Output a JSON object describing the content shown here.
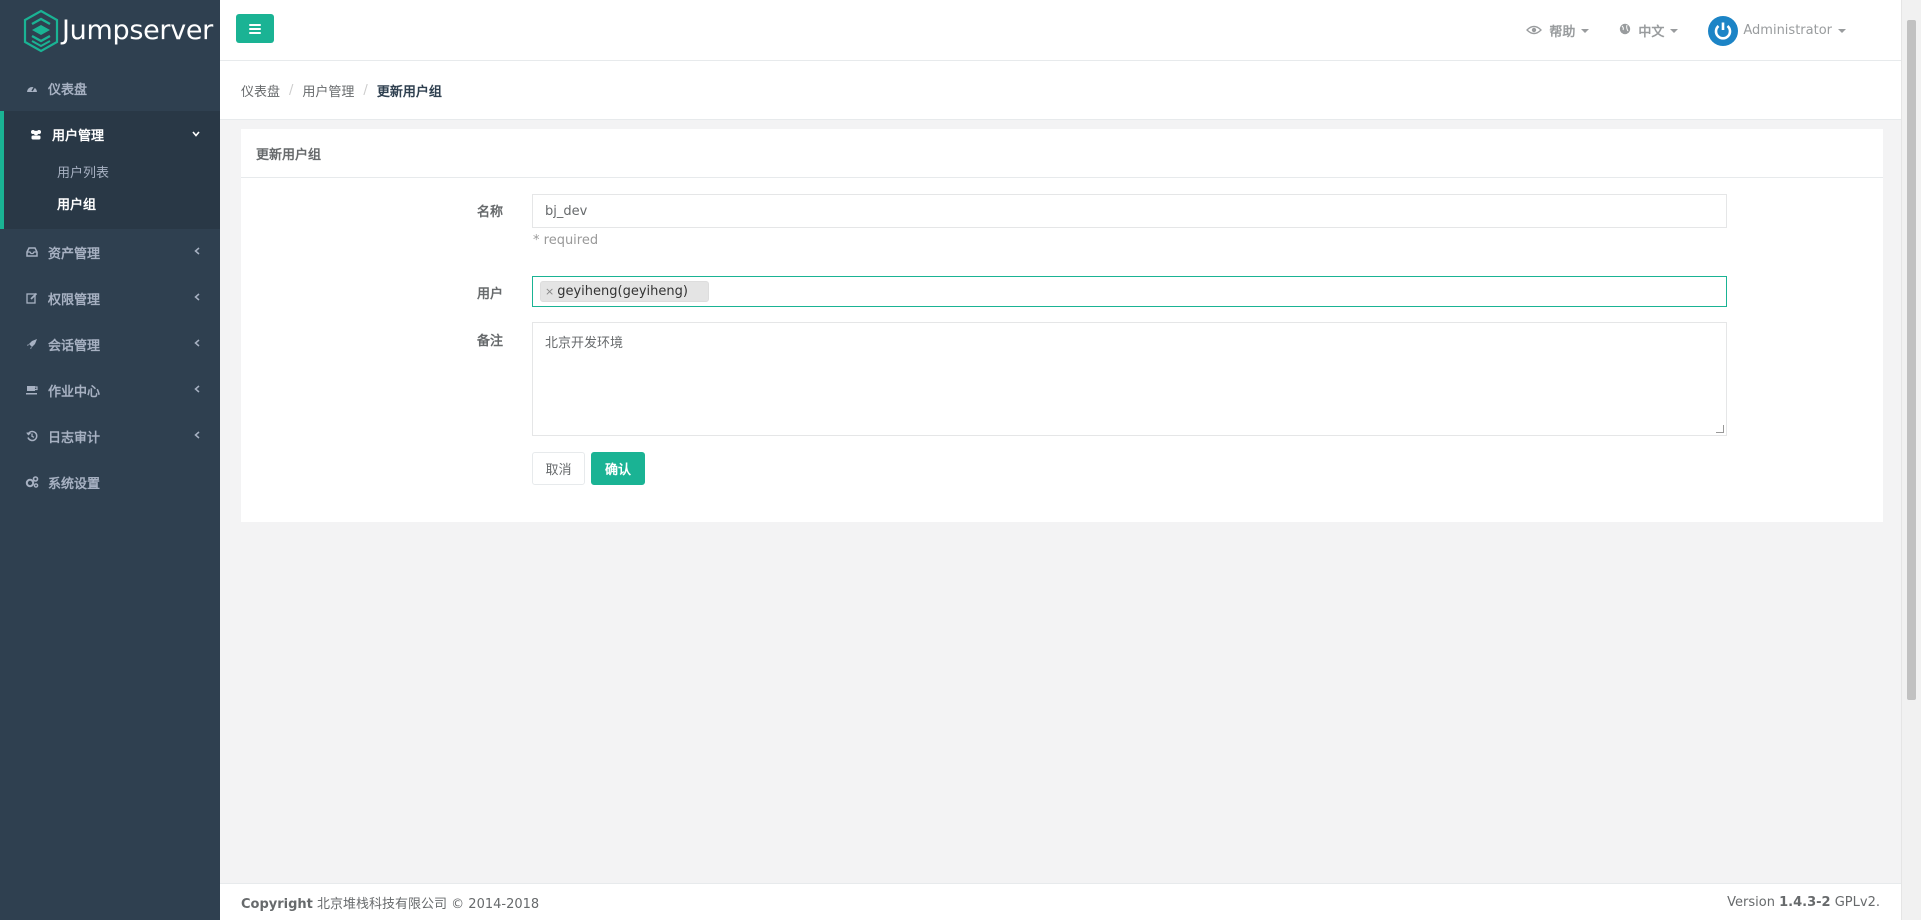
{
  "brand": {
    "name": "Jumpserver"
  },
  "sidebar": {
    "items": [
      {
        "label": "仪表盘",
        "icon": "dashboard-icon",
        "has_children": false
      },
      {
        "label": "用户管理",
        "icon": "users-icon",
        "has_children": true,
        "expanded": true,
        "children": [
          {
            "label": "用户列表"
          },
          {
            "label": "用户组",
            "current": true
          }
        ]
      },
      {
        "label": "资产管理",
        "icon": "inbox-icon",
        "has_children": true
      },
      {
        "label": "权限管理",
        "icon": "edit-icon",
        "has_children": true
      },
      {
        "label": "会话管理",
        "icon": "rocket-icon",
        "has_children": true
      },
      {
        "label": "作业中心",
        "icon": "coffee-icon",
        "has_children": true
      },
      {
        "label": "日志审计",
        "icon": "history-icon",
        "has_children": true
      },
      {
        "label": "系统设置",
        "icon": "gears-icon",
        "has_children": false
      }
    ]
  },
  "topbar": {
    "help_label": "帮助",
    "lang_label": "中文",
    "user_label": "Administrator"
  },
  "breadcrumb": [
    "仪表盘",
    "用户管理",
    "更新用户组"
  ],
  "panel": {
    "title": "更新用户组",
    "name_label": "名称",
    "name_value": "bj_dev",
    "name_help": "* required",
    "users_label": "用户",
    "users_selected": [
      "geyiheng(geyiheng)"
    ],
    "comment_label": "备注",
    "comment_value": "北京开发环境",
    "cancel_label": "取消",
    "submit_label": "确认"
  },
  "footer": {
    "copyright_prefix": "Copyright",
    "copyright_text": "北京堆栈科技有限公司 © 2014-2018",
    "version_prefix": "Version",
    "version_number": "1.4.3-2",
    "version_suffix": "GPLv2."
  },
  "colors": {
    "accent": "#1ab394",
    "sidebar": "#2f4050",
    "avatar": "#1c84c6"
  }
}
